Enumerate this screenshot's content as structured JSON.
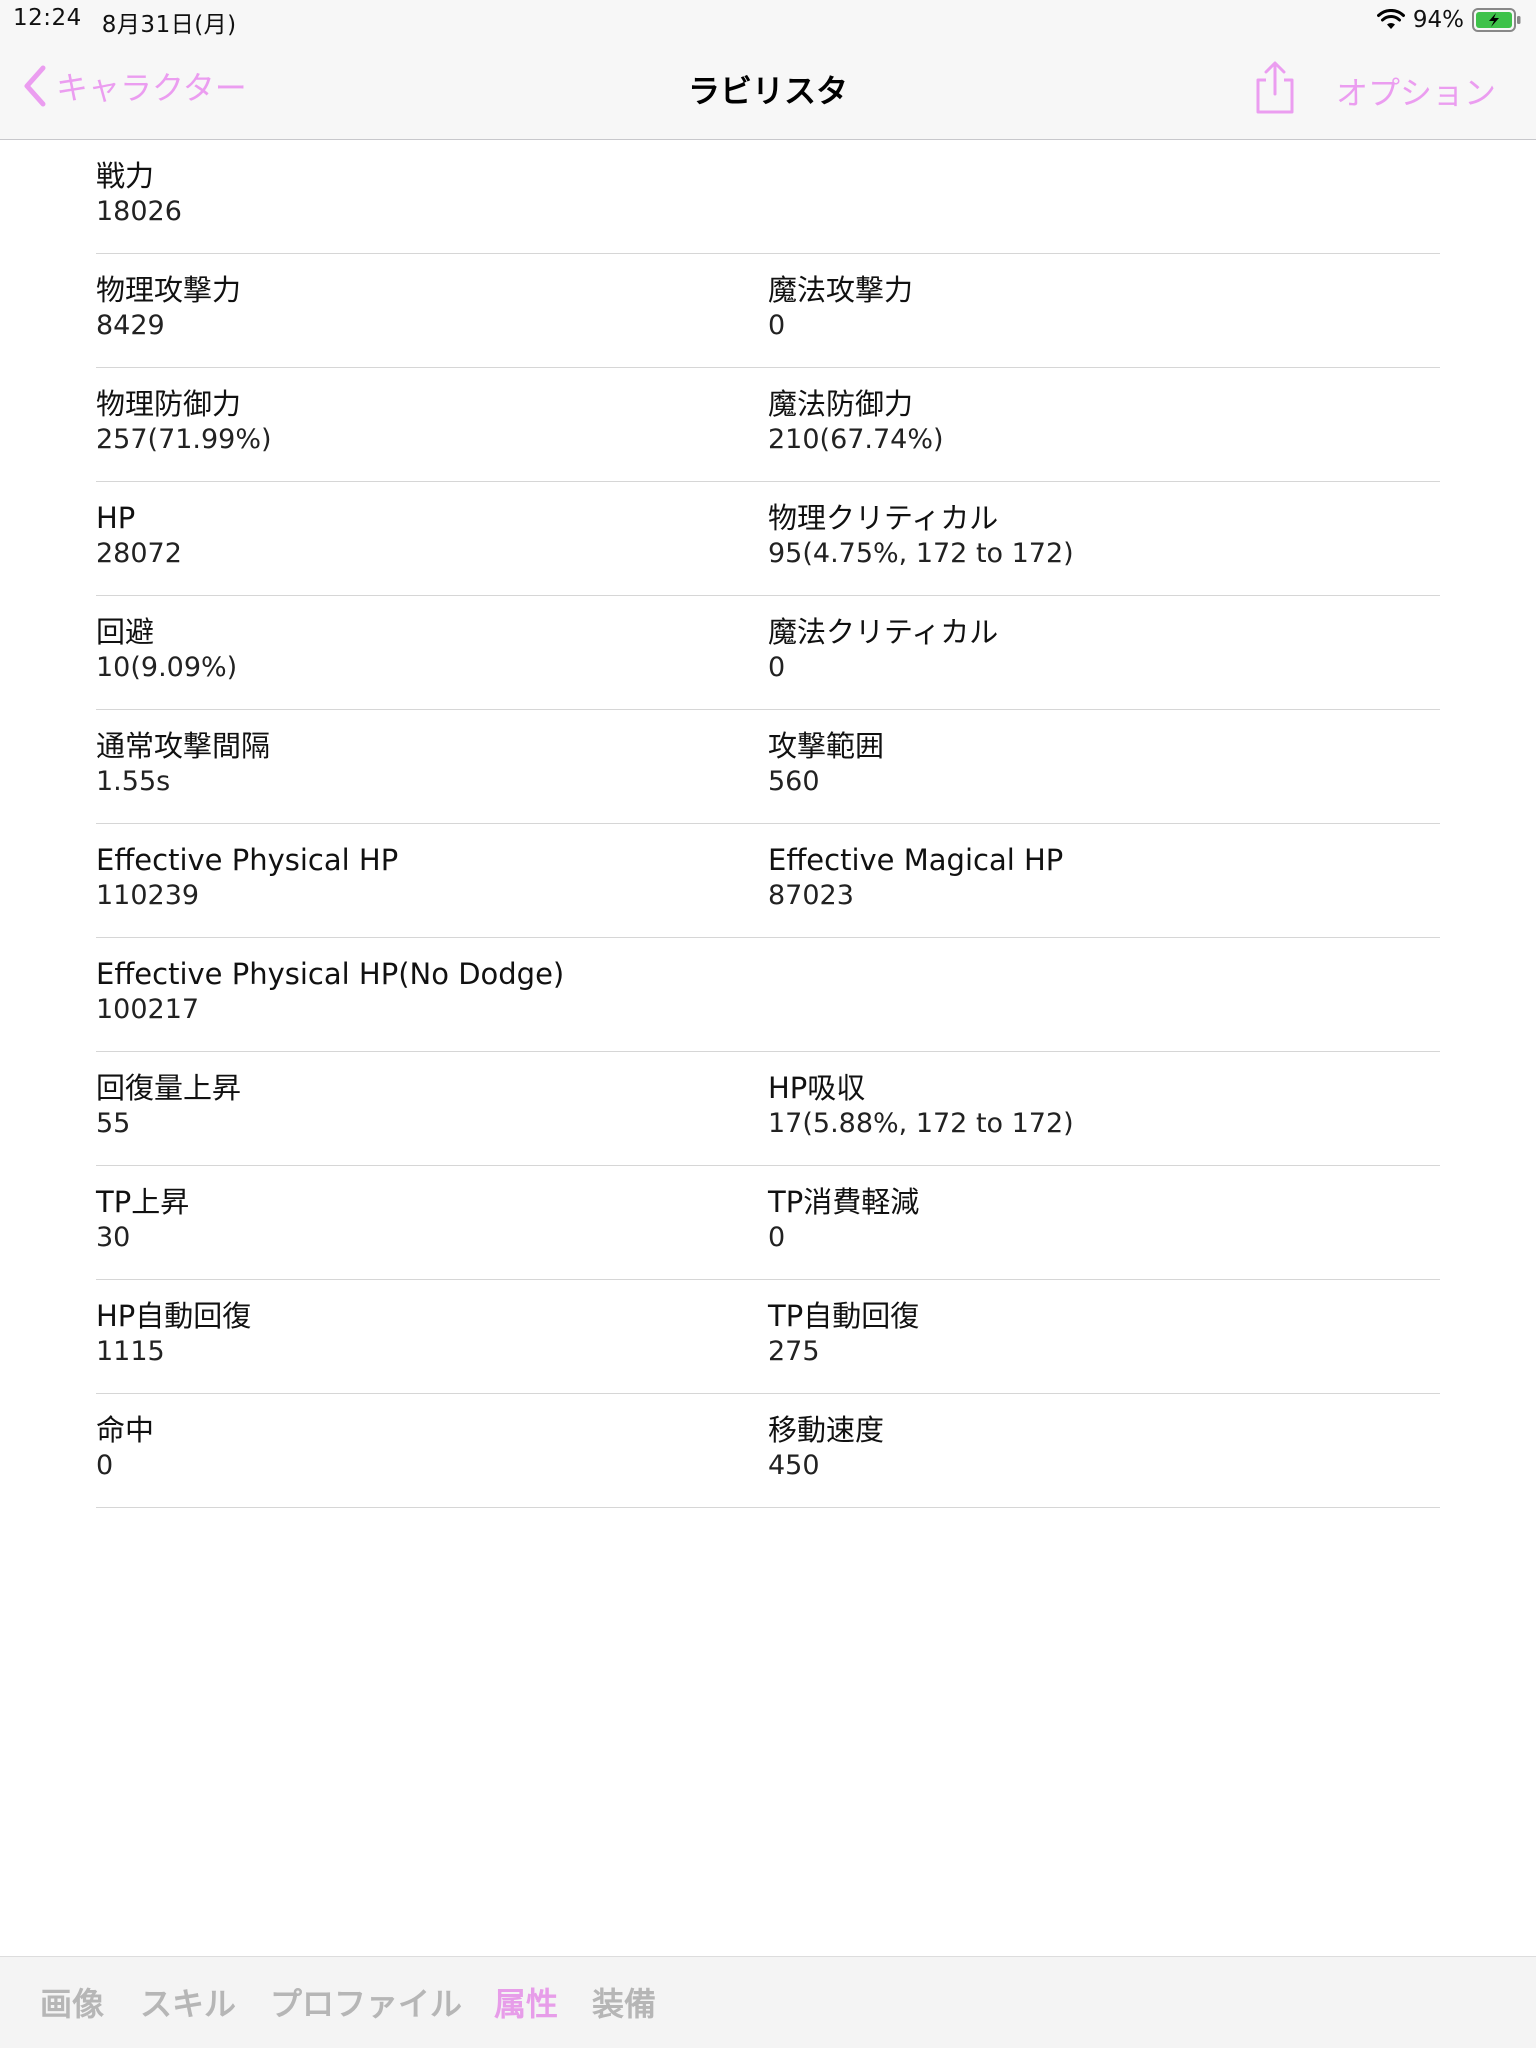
{
  "status_bar": {
    "time": "12:24",
    "date": "8月31日(月)",
    "battery": "94%"
  },
  "nav": {
    "back_label": "キャラクター",
    "title": "ラビリスタ",
    "option_label": "オプション",
    "accent_color": "#eb9df0"
  },
  "stats": {
    "row0": {
      "left_label": "戦力",
      "left_value": "18026"
    },
    "row1": {
      "left_label": "物理攻撃力",
      "left_value": "8429",
      "right_label": "魔法攻撃力",
      "right_value": "0"
    },
    "row2": {
      "left_label": "物理防御力",
      "left_value": "257(71.99%)",
      "right_label": "魔法防御力",
      "right_value": "210(67.74%)"
    },
    "row3": {
      "left_label": "HP",
      "left_value": "28072",
      "right_label": "物理クリティカル",
      "right_value": "95(4.75%, 172 to 172)"
    },
    "row4": {
      "left_label": "回避",
      "left_value": "10(9.09%)",
      "right_label": "魔法クリティカル",
      "right_value": "0"
    },
    "row5": {
      "left_label": "通常攻撃間隔",
      "left_value": "1.55s",
      "right_label": "攻撃範囲",
      "right_value": "560"
    },
    "row6": {
      "left_label": "Effective Physical HP",
      "left_value": "110239",
      "right_label": "Effective Magical HP",
      "right_value": "87023"
    },
    "row7": {
      "left_label": "Effective Physical HP(No Dodge)",
      "left_value": "100217"
    },
    "row8": {
      "left_label": "回復量上昇",
      "left_value": "55",
      "right_label": "HP吸収",
      "right_value": "17(5.88%, 172 to 172)"
    },
    "row9": {
      "left_label": "TP上昇",
      "left_value": "30",
      "right_label": "TP消費軽減",
      "right_value": "0"
    },
    "row10": {
      "left_label": "HP自動回復",
      "left_value": "1115",
      "right_label": "TP自動回復",
      "right_value": "275"
    },
    "row11": {
      "left_label": "命中",
      "left_value": "0",
      "right_label": "移動速度",
      "right_value": "450"
    }
  },
  "tabs": [
    {
      "label": "画像"
    },
    {
      "label": "スキル"
    },
    {
      "label": "プロファイル"
    },
    {
      "label": "属性",
      "active": true
    },
    {
      "label": "装備"
    }
  ],
  "icons": [
    "wifi-icon",
    "battery-icon",
    "chevron-left-icon",
    "share-icon"
  ]
}
